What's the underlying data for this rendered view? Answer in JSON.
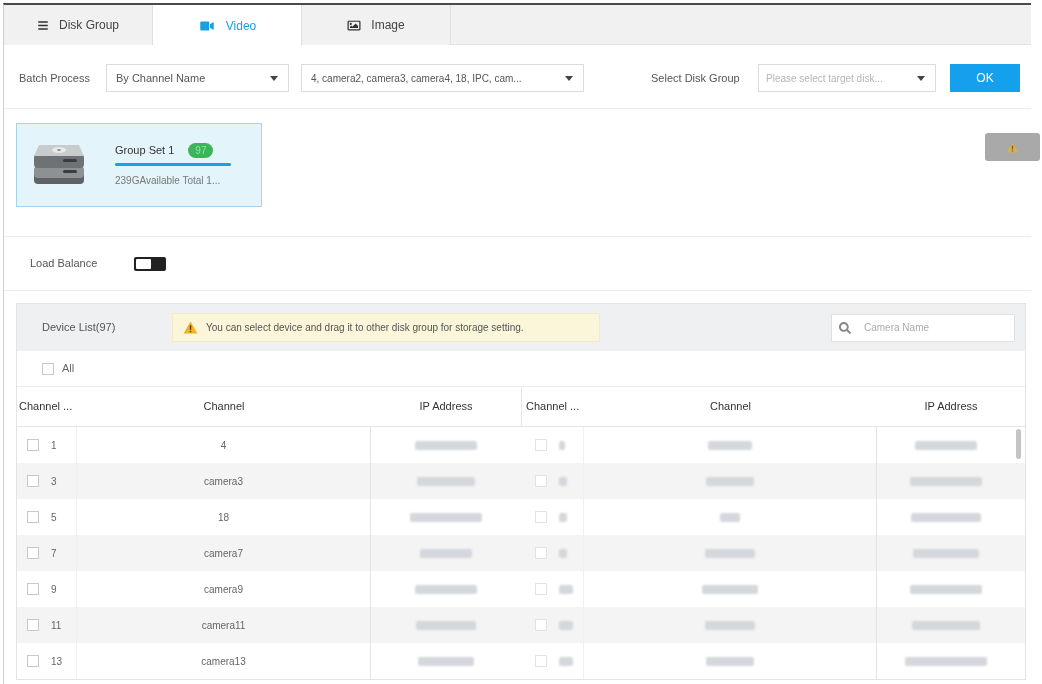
{
  "tabs": [
    {
      "label": "Disk Group",
      "kind": "list",
      "selected": false
    },
    {
      "label": "Video",
      "kind": "video",
      "selected": true
    },
    {
      "label": "Image",
      "kind": "image",
      "selected": false
    }
  ],
  "batch": {
    "label": "Batch Process",
    "mode": "By Channel Name",
    "channels": "4, camera2, camera3, camera4, 18, IPC, cam...",
    "disk_group_label": "Select Disk Group",
    "disk_group_placeholder": "Please select target disk...",
    "ok": "OK"
  },
  "disk_groups": [
    {
      "name": "Group Set 1",
      "count": "97",
      "level": 1,
      "capacity": "239GAvailable Total 1...",
      "selected": true
    }
  ],
  "load_balance": {
    "label": "Load Balance",
    "on": false
  },
  "device_list": {
    "title": "Device List(97)",
    "hint": "You can select device and drag it to other disk group for storage setting.",
    "search_placeholder": "Camera Name",
    "select_all": {
      "label": "All",
      "checked": false
    },
    "columns": [
      "Channel ...",
      "Channel",
      "IP Address",
      "Channel ...",
      "Channel",
      "IP Address"
    ],
    "rows": [
      {
        "left": {
          "number": "1",
          "channel": "4",
          "checked": false
        },
        "right": {
          "checked": false
        }
      },
      {
        "left": {
          "number": "3",
          "channel": "camera3",
          "checked": false
        },
        "right": {
          "checked": false
        }
      },
      {
        "left": {
          "number": "5",
          "channel": "18",
          "checked": false
        },
        "right": {
          "checked": false
        }
      },
      {
        "left": {
          "number": "7",
          "channel": "camera7",
          "checked": false
        },
        "right": {
          "checked": false
        }
      },
      {
        "left": {
          "number": "9",
          "channel": "camera9",
          "checked": false
        },
        "right": {
          "checked": false
        }
      },
      {
        "left": {
          "number": "11",
          "channel": "camera11",
          "checked": false
        },
        "right": {
          "checked": false
        }
      },
      {
        "left": {
          "number": "13",
          "channel": "camera13",
          "checked": false
        },
        "right": {
          "checked": false
        }
      }
    ]
  }
}
